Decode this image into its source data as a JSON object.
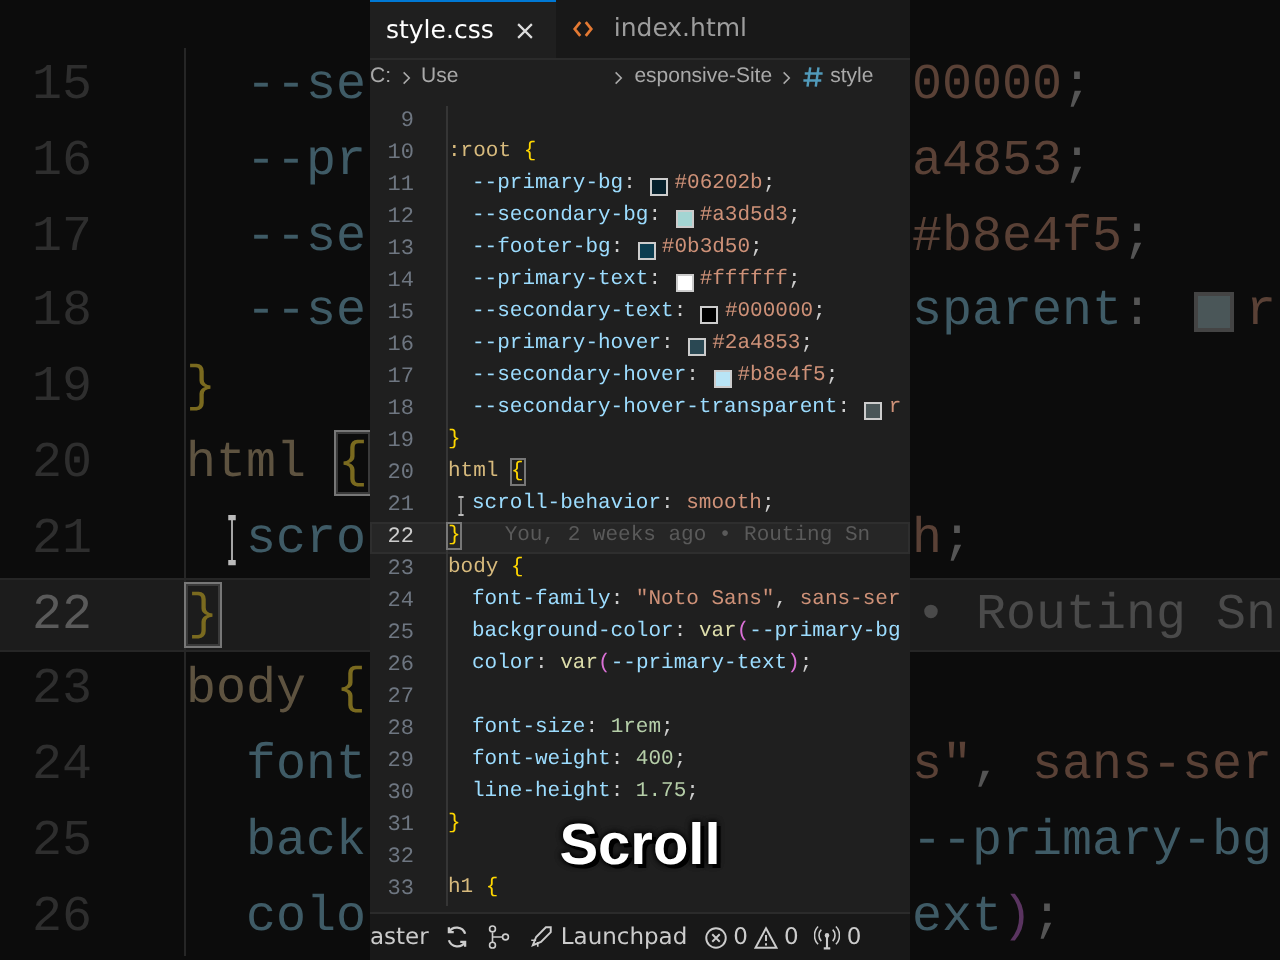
{
  "background_left": [
    {
      "number": "15",
      "current": false,
      "indented": true,
      "tokens": [
        {
          "kind": "property",
          "text": "--se"
        }
      ]
    },
    {
      "number": "16",
      "current": false,
      "indented": true,
      "tokens": [
        {
          "kind": "property",
          "text": "--pr"
        }
      ]
    },
    {
      "number": "17",
      "current": false,
      "indented": true,
      "tokens": [
        {
          "kind": "property",
          "text": "--se"
        }
      ]
    },
    {
      "number": "18",
      "current": false,
      "indented": true,
      "tokens": [
        {
          "kind": "property",
          "text": "--se"
        }
      ]
    },
    {
      "number": "19",
      "current": false,
      "indented": false,
      "tokens": [
        {
          "kind": "brace",
          "text": "}"
        }
      ]
    },
    {
      "number": "20",
      "current": false,
      "indented": false,
      "tokens": [
        {
          "kind": "selector",
          "text": "html "
        },
        {
          "kind": "brace_match",
          "text": "{"
        }
      ]
    },
    {
      "number": "21",
      "current": false,
      "indented": true,
      "tokens": [
        {
          "kind": "ibeam"
        },
        {
          "kind": "property",
          "text": "scro"
        }
      ]
    },
    {
      "number": "22",
      "current": true,
      "indented": false,
      "tokens": [
        {
          "kind": "brace_match",
          "text": "}"
        }
      ]
    },
    {
      "number": "23",
      "current": false,
      "indented": false,
      "tokens": [
        {
          "kind": "selector",
          "text": "body "
        },
        {
          "kind": "brace",
          "text": "{"
        }
      ]
    },
    {
      "number": "24",
      "current": false,
      "indented": true,
      "tokens": [
        {
          "kind": "property",
          "text": "font"
        }
      ]
    },
    {
      "number": "25",
      "current": false,
      "indented": true,
      "tokens": [
        {
          "kind": "property",
          "text": "back"
        }
      ]
    },
    {
      "number": "26",
      "current": false,
      "indented": true,
      "tokens": [
        {
          "kind": "property",
          "text": "colo"
        }
      ]
    }
  ],
  "background_right": [
    {
      "current": false,
      "tokens": [
        {
          "kind": "value",
          "text": "00000"
        },
        {
          "kind": "punct",
          "text": ";"
        }
      ]
    },
    {
      "current": false,
      "tokens": [
        {
          "kind": "value",
          "text": "a4853"
        },
        {
          "kind": "punct",
          "text": ";"
        }
      ]
    },
    {
      "current": false,
      "tokens": [
        {
          "kind": "value",
          "text": "#b8e4f5"
        },
        {
          "kind": "punct",
          "text": ";"
        }
      ]
    },
    {
      "current": false,
      "tokens": [
        {
          "kind": "property",
          "text": "sparent"
        },
        {
          "kind": "punct",
          "text": ": "
        },
        {
          "kind": "swatch",
          "color": "#4a5658"
        },
        {
          "kind": "value",
          "text": "r"
        }
      ]
    },
    {
      "current": false
    },
    {
      "current": false
    },
    {
      "current": false,
      "tokens": [
        {
          "kind": "value",
          "text": "h"
        },
        {
          "kind": "punct",
          "text": ";"
        }
      ]
    },
    {
      "current": true,
      "blame": "• Routing Sn"
    },
    {
      "current": false
    },
    {
      "current": false,
      "tokens": [
        {
          "kind": "value",
          "text": "s\""
        },
        {
          "kind": "punct",
          "text": ", "
        },
        {
          "kind": "value",
          "text": "sans-ser"
        }
      ]
    },
    {
      "current": false,
      "tokens": [
        {
          "kind": "property",
          "text": "--primary-bg"
        }
      ]
    },
    {
      "current": false,
      "tokens": [
        {
          "kind": "property",
          "text": "ext"
        },
        {
          "kind": "paren",
          "text": ")"
        },
        {
          "kind": "punct",
          "text": ";"
        }
      ]
    }
  ],
  "tabs": [
    {
      "label": "style.css",
      "selected": true,
      "closable": true
    },
    {
      "label": "index.html",
      "selected": false,
      "closable": false
    }
  ],
  "breadcrumb": [
    "C:",
    "Use",
    "esponsive-Site",
    "style"
  ],
  "editor": {
    "lines": [
      {
        "number": "9",
        "current": false,
        "indented": false
      },
      {
        "number": "10",
        "current": false,
        "indented": false,
        "tokens": [
          {
            "kind": "selector",
            "text": ":root "
          },
          {
            "kind": "brace",
            "text": "{"
          }
        ]
      },
      {
        "number": "11",
        "current": false,
        "indented": true,
        "tokens": [
          {
            "kind": "property",
            "text": "--primary-bg"
          },
          {
            "kind": "punct",
            "text": ": "
          },
          {
            "kind": "swatch",
            "color": "#06202b"
          },
          {
            "kind": "value",
            "text": "#06202b"
          },
          {
            "kind": "punct",
            "text": ";"
          }
        ]
      },
      {
        "number": "12",
        "current": false,
        "indented": true,
        "tokens": [
          {
            "kind": "property",
            "text": "--secondary-bg"
          },
          {
            "kind": "punct",
            "text": ": "
          },
          {
            "kind": "swatch",
            "color": "#a3d5d3"
          },
          {
            "kind": "value",
            "text": "#a3d5d3"
          },
          {
            "kind": "punct",
            "text": ";"
          }
        ]
      },
      {
        "number": "13",
        "current": false,
        "indented": true,
        "tokens": [
          {
            "kind": "property",
            "text": "--footer-bg"
          },
          {
            "kind": "punct",
            "text": ": "
          },
          {
            "kind": "swatch",
            "color": "#0b3d50"
          },
          {
            "kind": "value",
            "text": "#0b3d50"
          },
          {
            "kind": "punct",
            "text": ";"
          }
        ]
      },
      {
        "number": "14",
        "current": false,
        "indented": true,
        "tokens": [
          {
            "kind": "property",
            "text": "--primary-text"
          },
          {
            "kind": "punct",
            "text": ": "
          },
          {
            "kind": "swatch",
            "color": "#ffffff"
          },
          {
            "kind": "value",
            "text": "#ffffff"
          },
          {
            "kind": "punct",
            "text": ";"
          }
        ]
      },
      {
        "number": "15",
        "current": false,
        "indented": true,
        "tokens": [
          {
            "kind": "property",
            "text": "--secondary-text"
          },
          {
            "kind": "punct",
            "text": ": "
          },
          {
            "kind": "swatch",
            "color": "#000000"
          },
          {
            "kind": "value",
            "text": "#000000"
          },
          {
            "kind": "punct",
            "text": ";"
          }
        ]
      },
      {
        "number": "16",
        "current": false,
        "indented": true,
        "tokens": [
          {
            "kind": "property",
            "text": "--primary-hover"
          },
          {
            "kind": "punct",
            "text": ": "
          },
          {
            "kind": "swatch",
            "color": "#2a4853"
          },
          {
            "kind": "value",
            "text": "#2a4853"
          },
          {
            "kind": "punct",
            "text": ";"
          }
        ]
      },
      {
        "number": "17",
        "current": false,
        "indented": true,
        "tokens": [
          {
            "kind": "property",
            "text": "--secondary-hover"
          },
          {
            "kind": "punct",
            "text": ": "
          },
          {
            "kind": "swatch",
            "color": "#b8e4f5"
          },
          {
            "kind": "value",
            "text": "#b8e4f5"
          },
          {
            "kind": "punct",
            "text": ";"
          }
        ]
      },
      {
        "number": "18",
        "current": false,
        "indented": true,
        "tokens": [
          {
            "kind": "property",
            "text": "--secondary-hover-transparent"
          },
          {
            "kind": "punct",
            "text": ": "
          },
          {
            "kind": "swatch",
            "color": "#4a5658"
          },
          {
            "kind": "value",
            "text": "r"
          }
        ]
      },
      {
        "number": "19",
        "current": false,
        "indented": false,
        "tokens": [
          {
            "kind": "brace",
            "text": "}"
          }
        ]
      },
      {
        "number": "20",
        "current": false,
        "indented": false,
        "tokens": [
          {
            "kind": "selector",
            "text": "html "
          },
          {
            "kind": "brace_match",
            "text": "{"
          }
        ]
      },
      {
        "number": "21",
        "current": false,
        "indented": true,
        "tokens": [
          {
            "kind": "ibeam"
          },
          {
            "kind": "property",
            "text": "scroll-behavior"
          },
          {
            "kind": "punct",
            "text": ": "
          },
          {
            "kind": "value",
            "text": "smooth"
          },
          {
            "kind": "punct",
            "text": ";"
          }
        ]
      },
      {
        "number": "22",
        "current": true,
        "indented": false,
        "blame": "You, 2 weeks ago • Routing Sn",
        "tokens": [
          {
            "kind": "brace_match",
            "text": "}"
          }
        ]
      },
      {
        "number": "23",
        "current": false,
        "indented": false,
        "tokens": [
          {
            "kind": "selector",
            "text": "body "
          },
          {
            "kind": "brace",
            "text": "{"
          }
        ]
      },
      {
        "number": "24",
        "current": false,
        "indented": true,
        "tokens": [
          {
            "kind": "property",
            "text": "font-family"
          },
          {
            "kind": "punct",
            "text": ": "
          },
          {
            "kind": "value",
            "text": "\"Noto Sans\""
          },
          {
            "kind": "punct",
            "text": ", "
          },
          {
            "kind": "value",
            "text": "sans-ser"
          }
        ]
      },
      {
        "number": "25",
        "current": false,
        "indented": true,
        "tokens": [
          {
            "kind": "property",
            "text": "background-color"
          },
          {
            "kind": "punct",
            "text": ": "
          },
          {
            "kind": "func",
            "text": "var"
          },
          {
            "kind": "paren",
            "text": "("
          },
          {
            "kind": "property",
            "text": "--primary-bg"
          }
        ]
      },
      {
        "number": "26",
        "current": false,
        "indented": true,
        "tokens": [
          {
            "kind": "property",
            "text": "color"
          },
          {
            "kind": "punct",
            "text": ": "
          },
          {
            "kind": "func",
            "text": "var"
          },
          {
            "kind": "paren",
            "text": "("
          },
          {
            "kind": "property",
            "text": "--primary-text"
          },
          {
            "kind": "paren",
            "text": ")"
          },
          {
            "kind": "punct",
            "text": ";"
          }
        ]
      },
      {
        "number": "27",
        "current": false,
        "indented": true
      },
      {
        "number": "28",
        "current": false,
        "indented": true,
        "tokens": [
          {
            "kind": "property",
            "text": "font-size"
          },
          {
            "kind": "punct",
            "text": ": "
          },
          {
            "kind": "number",
            "text": "1rem"
          },
          {
            "kind": "punct",
            "text": ";"
          }
        ]
      },
      {
        "number": "29",
        "current": false,
        "indented": true,
        "tokens": [
          {
            "kind": "property",
            "text": "font-weight"
          },
          {
            "kind": "punct",
            "text": ": "
          },
          {
            "kind": "number",
            "text": "400"
          },
          {
            "kind": "punct",
            "text": ";"
          }
        ]
      },
      {
        "number": "30",
        "current": false,
        "indented": true,
        "tokens": [
          {
            "kind": "property",
            "text": "line-height"
          },
          {
            "kind": "punct",
            "text": ": "
          },
          {
            "kind": "number",
            "text": "1.75"
          },
          {
            "kind": "punct",
            "text": ";"
          }
        ]
      },
      {
        "number": "31",
        "current": false,
        "indented": false,
        "tokens": [
          {
            "kind": "brace",
            "text": "}"
          }
        ]
      },
      {
        "number": "32",
        "current": false,
        "indented": false
      },
      {
        "number": "33",
        "current": false,
        "indented": false,
        "tokens": [
          {
            "kind": "selector",
            "text": "h1 "
          },
          {
            "kind": "brace",
            "text": "{"
          }
        ]
      }
    ]
  },
  "caption": "Scroll",
  "status_bar": {
    "branch": "aster",
    "launchpad": "Launchpad",
    "errors": "0",
    "warnings": "0",
    "ports": "0"
  }
}
